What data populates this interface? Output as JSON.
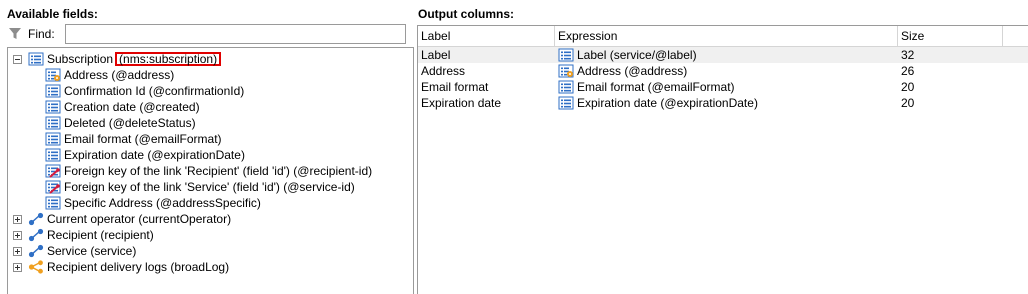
{
  "left_panel": {
    "title": "Available fields:",
    "find_label": "Find:",
    "find_value": "",
    "tree": [
      {
        "label": "Subscription",
        "badge": "(nms:subscription)",
        "icon": "table-list-icon",
        "expander": "minus",
        "level": 0
      },
      {
        "label": "Address (@address)",
        "icon": "list-gear-icon",
        "level": 1
      },
      {
        "label": "Confirmation Id (@confirmationId)",
        "icon": "list-icon",
        "level": 1
      },
      {
        "label": "Creation date (@created)",
        "icon": "list-icon",
        "level": 1
      },
      {
        "label": "Deleted (@deleteStatus)",
        "icon": "list-icon",
        "level": 1
      },
      {
        "label": "Email format (@emailFormat)",
        "icon": "list-icon",
        "level": 1
      },
      {
        "label": "Expiration date (@expirationDate)",
        "icon": "list-icon",
        "level": 1
      },
      {
        "label": "Foreign key of the link 'Recipient' (field 'id') (@recipient-id)",
        "icon": "foreign-key-icon",
        "level": 1
      },
      {
        "label": "Foreign key of the link 'Service' (field 'id') (@service-id)",
        "icon": "foreign-key-icon",
        "level": 1
      },
      {
        "label": "Specific Address (@addressSpecific)",
        "icon": "list-icon",
        "level": 1
      },
      {
        "label": "Current operator (currentOperator)",
        "icon": "link-icon",
        "expander": "plus",
        "level": 0
      },
      {
        "label": "Recipient (recipient)",
        "icon": "link-icon",
        "expander": "plus",
        "level": 0
      },
      {
        "label": "Service (service)",
        "icon": "link-icon",
        "expander": "plus",
        "level": 0
      },
      {
        "label": "Recipient delivery logs (broadLog)",
        "icon": "collection-link-icon",
        "expander": "plus",
        "level": 0
      }
    ]
  },
  "right_panel": {
    "title": "Output columns:",
    "columns": [
      "Label",
      "Expression",
      "Size"
    ],
    "rows": [
      {
        "label": "Label",
        "expression": "Label (service/@label)",
        "icon": "list-icon",
        "size": "32",
        "selected": true
      },
      {
        "label": "Address",
        "expression": "Address (@address)",
        "icon": "list-gear-icon",
        "size": "26",
        "selected": false
      },
      {
        "label": "Email format",
        "expression": "Email format (@emailFormat)",
        "icon": "list-icon",
        "size": "20",
        "selected": false
      },
      {
        "label": "Expiration date",
        "expression": "Expiration date (@expirationDate)",
        "icon": "list-icon",
        "size": "20",
        "selected": false
      }
    ]
  },
  "colors": {
    "highlight_border": "#e00000",
    "icon_blue": "#2f6fc5",
    "icon_orange": "#f0a020",
    "key_red": "#d81b3c",
    "selected_row": "#f0f0f0"
  }
}
